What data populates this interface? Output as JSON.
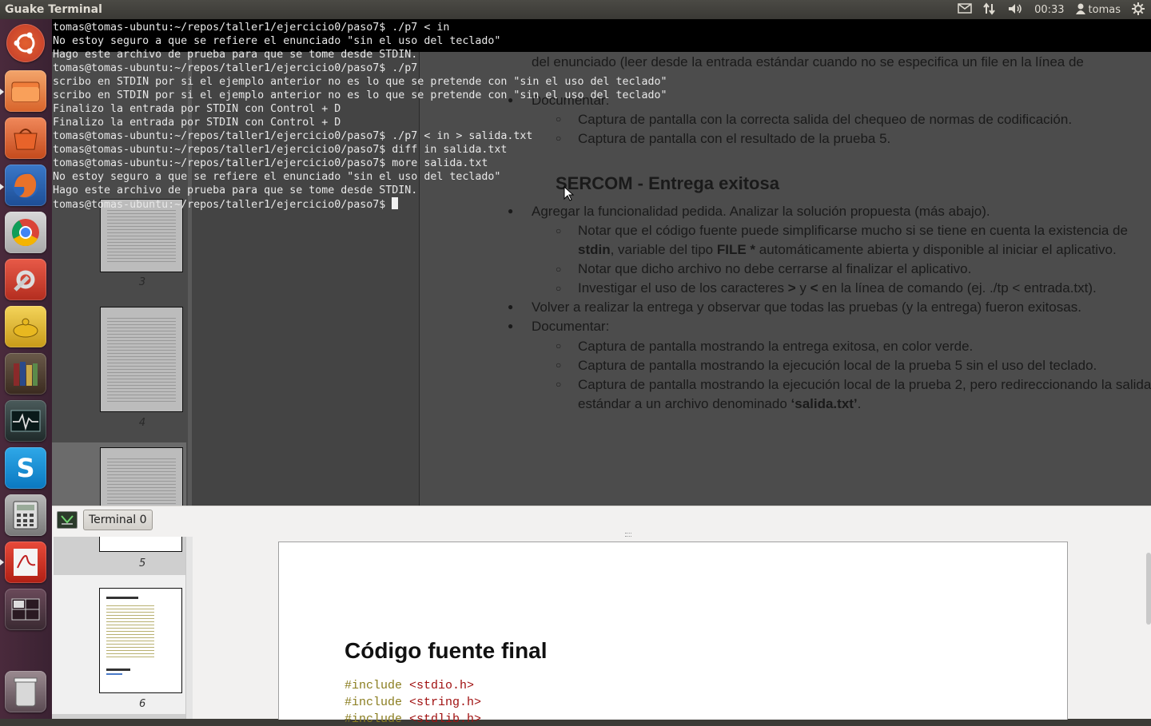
{
  "top_panel": {
    "title": "Guake Terminal",
    "clock": "00:33",
    "user": "tomas",
    "icons": [
      "mail-icon",
      "network-icon",
      "volume-icon",
      "user-icon",
      "gear-icon"
    ]
  },
  "launcher": {
    "items": [
      "ubuntu-dash",
      "files",
      "software-center",
      "firefox",
      "chrome",
      "system-settings",
      "genie",
      "library",
      "system-monitor",
      "skype",
      "calculator",
      "pdf-reader",
      "workspace-switcher",
      "trash"
    ]
  },
  "terminal": {
    "lines": [
      "tomas@tomas-ubuntu:~/repos/taller1/ejercicio0/paso7$ ./p7 < in",
      "No estoy seguro a que se refiere el enunciado \"sin el uso del teclado\"",
      "Hago este archivo de prueba para que se tome desde STDIN.",
      "tomas@tomas-ubuntu:~/repos/taller1/ejercicio0/paso7$ ./p7",
      "scribo en STDIN por si el ejemplo anterior no es lo que se pretende con \"sin el uso del teclado\"",
      "scribo en STDIN por si el ejemplo anterior no es lo que se pretende con \"sin el uso del teclado\"",
      "Finalizo la entrada por STDIN con Control + D",
      "Finalizo la entrada por STDIN con Control + D",
      "tomas@tomas-ubuntu:~/repos/taller1/ejercicio0/paso7$ ./p7 < in > salida.txt",
      "tomas@tomas-ubuntu:~/repos/taller1/ejercicio0/paso7$ diff in salida.txt",
      "tomas@tomas-ubuntu:~/repos/taller1/ejercicio0/paso7$ more salida.txt",
      "No estoy seguro a que se refiere el enunciado \"sin el uso del teclado\"",
      "Hago este archivo de prueba para que se tome desde STDIN.",
      "tomas@tomas-ubuntu:~/repos/taller1/ejercicio0/paso7$ "
    ],
    "tab_label": "Terminal 0"
  },
  "document": {
    "lines": {
      "l1": "del enunciado (leer desde la entrada estándar cuando no se especifica un file en la línea de",
      "l2": "Documentar:",
      "l3": "Captura de pantalla con la correcta salida del chequeo de normas de codificación.",
      "l4": "Captura de pantalla con el resultado de la prueba 5.",
      "heading": "SERCOM - Entrega exitosa",
      "l5": "Agregar la funcionalidad pedida. Analizar la solución propuesta (más abajo).",
      "l6": "Notar que el código fuente puede simplificarse mucho si se tiene en cuenta la existencia de",
      "l7a": "stdin",
      "l7b": ", variable del tipo ",
      "l7c": "FILE *",
      "l7d": " automáticamente abierta y disponible al iniciar el aplicativo.",
      "l8": "Notar que dicho archivo no debe cerrarse al finalizar el aplicativo.",
      "l9a": "Investigar el uso de los caracteres ",
      "l9b": ">",
      "l9c": " y ",
      "l9d": "<",
      "l9e": " en la línea de comando (ej. ./tp < entrada.txt).",
      "l10": "Volver a realizar la entrega y observar que todas las pruebas (y la entrega) fueron exitosas.",
      "l11": "Documentar:",
      "l12": "Captura de pantalla mostrando la entrega exitosa, en color verde.",
      "l13": "Captura de pantalla mostrando la ejecución local de la prueba 5 sin el uso del teclado.",
      "l14": "Captura de pantalla mostrando la ejecución local de la prueba 2, pero redireccionando la salida",
      "l15a": "estándar a un archivo denominado ",
      "l15b": "‘salida.txt’",
      "l15c": "."
    },
    "final_heading": "Código fuente final",
    "code": [
      {
        "kw": "#include",
        "arg": "<stdio.h>"
      },
      {
        "kw": "#include",
        "arg": "<string.h>"
      },
      {
        "kw": "#include",
        "arg": "<stdlib.h>"
      }
    ],
    "thumb_numbers": [
      "3",
      "4",
      "5",
      "6"
    ]
  }
}
